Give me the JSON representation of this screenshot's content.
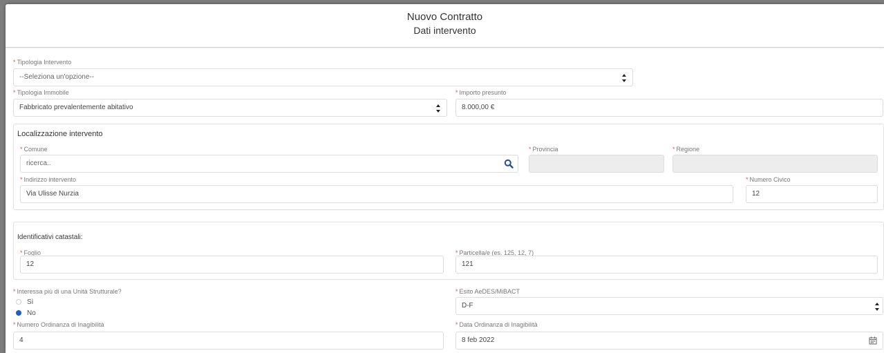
{
  "header": {
    "title": "Nuovo Contratto",
    "subtitle": "Dati intervento"
  },
  "required_mark": "*",
  "tipologia_intervento": {
    "label": "Tipologia Intervento",
    "value": "--Seleziona un'opzione--"
  },
  "tipologia_immobile": {
    "label": "Tipologia Immobile",
    "value": "Fabbricato prevalentemente abitativo"
  },
  "importo_presunto": {
    "label": "Importo presunto",
    "value": "8.000,00 €"
  },
  "localizzazione": {
    "title": "Localizzazione intervento",
    "comune": {
      "label": "Comune",
      "placeholder": "ricerca.."
    },
    "provincia": {
      "label": "Provincia",
      "value": ""
    },
    "regione": {
      "label": "Regione",
      "value": ""
    },
    "indirizzo": {
      "label": "Indirizzo intervento",
      "value": "Via Ulisse Nurzia"
    },
    "numero_civico": {
      "label": "Numero Civico",
      "value": "12"
    }
  },
  "catastali": {
    "title": "Identificativi catastali:",
    "foglio": {
      "label": "Foglio",
      "value": "12"
    },
    "particella": {
      "label": "Particella/e (es. 125, 12, 7)",
      "value": "121"
    }
  },
  "unita_strutturale": {
    "label": "Interessa più di una Unità Strutturale?",
    "options": [
      "Sì",
      "No"
    ],
    "selected": "No"
  },
  "esito": {
    "label": "Esito AeDES/MiBACT",
    "value": "D-F"
  },
  "numero_ordinanza": {
    "label": "Numero Ordinanza di Inagibilità",
    "value": "4"
  },
  "data_ordinanza": {
    "label": "Data Ordinanza di Inagibilità",
    "value": "8 feb 2022"
  },
  "colors": {
    "required": "#d9534f",
    "accent": "#1f5fbf",
    "border": "#dcdcdc",
    "disabled_bg": "#ededed"
  },
  "icons": {
    "select": "select-arrows-icon",
    "search": "search-icon",
    "calendar": "calendar-icon"
  }
}
